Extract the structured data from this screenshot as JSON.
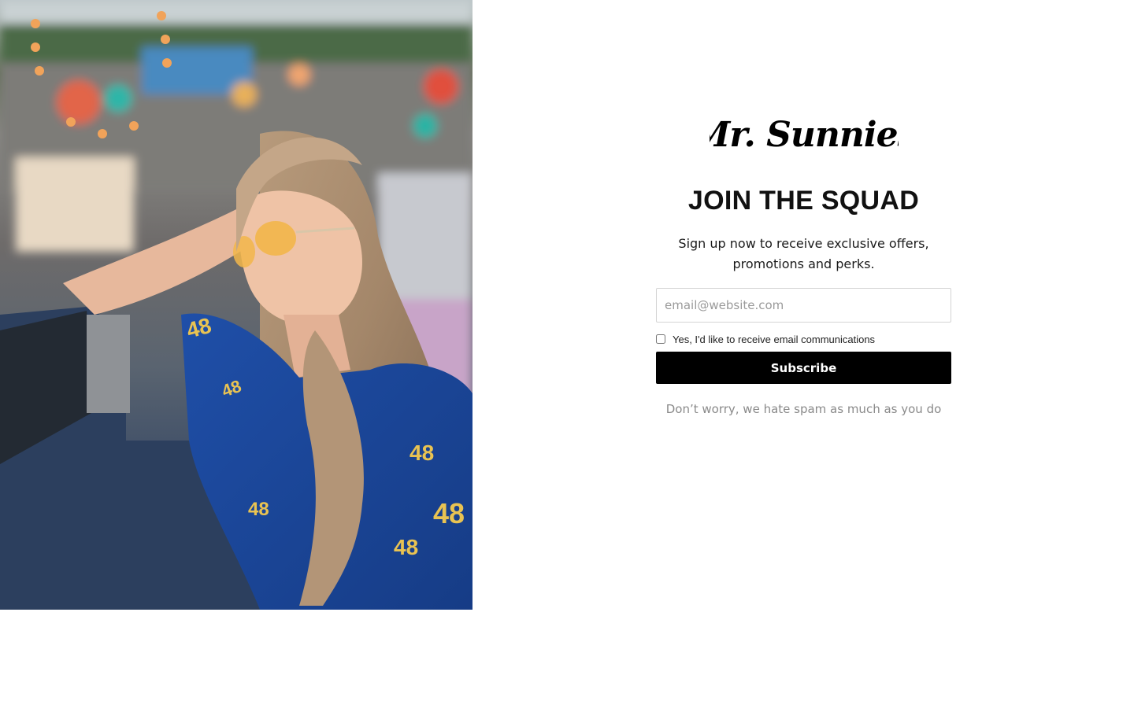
{
  "brand": {
    "logo_text": "Mr. Sunnies"
  },
  "hero": {
    "image_icon": "lifestyle-photo"
  },
  "signup": {
    "headline": "JOIN THE SQUAD",
    "subtext": "Sign up now to receive exclusive offers, promotions and perks.",
    "email_placeholder": "email@website.com",
    "email_value": "",
    "consent_label": "Yes, I'd like to receive email communications",
    "consent_checked": false,
    "subscribe_label": "Subscribe",
    "spam_note": "Don’t worry, we hate spam as much as you do"
  },
  "colors": {
    "button_bg": "#000000",
    "button_text": "#ffffff",
    "muted_text": "#8a8a8a",
    "border": "#d4d4d4"
  }
}
